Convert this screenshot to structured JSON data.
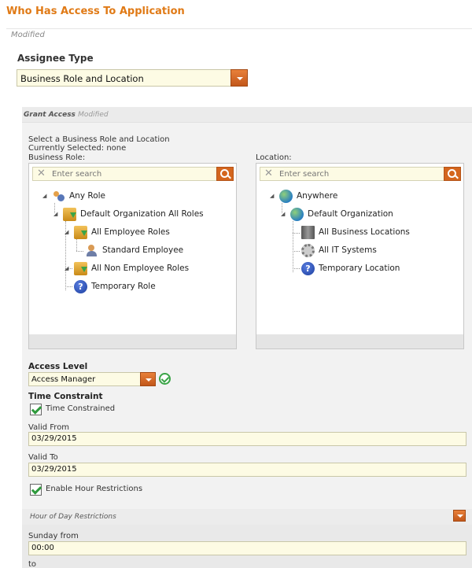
{
  "page": {
    "title": "Who Has Access To Application",
    "modified": "Modified"
  },
  "assignee": {
    "label": "Assignee Type",
    "value": "Business Role and Location"
  },
  "grant": {
    "header": "Grant Access",
    "modified": "Modified",
    "instruction": "Select a Business Role and Location",
    "selected": "Currently Selected: none",
    "role_label": "Business Role:",
    "location_label": "Location:"
  },
  "role_tree": {
    "search_placeholder": "Enter search",
    "nodes": [
      {
        "label": "Any Role",
        "icon": "people-icon"
      },
      {
        "label": "Default Organization All Roles",
        "icon": "folder-icon"
      },
      {
        "label": "All Employee Roles",
        "icon": "folder-icon"
      },
      {
        "label": "Standard Employee",
        "icon": "user-icon"
      },
      {
        "label": "All Non Employee Roles",
        "icon": "folder-icon"
      },
      {
        "label": "Temporary Role",
        "icon": "question-icon"
      }
    ]
  },
  "location_tree": {
    "search_placeholder": "Enter search",
    "nodes": [
      {
        "label": "Anywhere",
        "icon": "globe-icon"
      },
      {
        "label": "Default Organization",
        "icon": "globe-icon"
      },
      {
        "label": "All Business Locations",
        "icon": "building-icon"
      },
      {
        "label": "All IT Systems",
        "icon": "gear-icon"
      },
      {
        "label": "Temporary Location",
        "icon": "question-icon"
      }
    ]
  },
  "access": {
    "label": "Access Level",
    "value": "Access Manager"
  },
  "time": {
    "label": "Time Constraint",
    "constrained_label": "Time Constrained",
    "valid_from_label": "Valid From",
    "valid_from": "03/29/2015",
    "valid_to_label": "Valid To",
    "valid_to": "03/29/2015",
    "hour_label": "Enable Hour Restrictions"
  },
  "hours": {
    "header": "Hour of Day Restrictions",
    "sunday_from_label": "Sunday from",
    "sunday_from": "00:00",
    "to_label": "to"
  },
  "colors": {
    "accent": "#e07a16",
    "check": "#2e9a3c"
  }
}
